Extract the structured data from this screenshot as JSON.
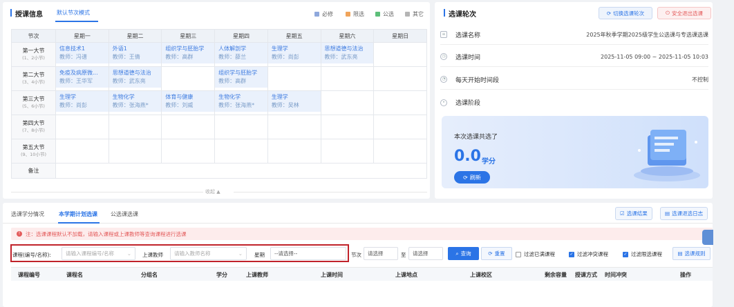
{
  "schedule": {
    "title": "授课信息",
    "mode_tab": "默认节次模式",
    "legend": [
      {
        "label": "必修",
        "color": "#8fa8dc"
      },
      {
        "label": "限选",
        "color": "#f0a45b"
      },
      {
        "label": "公选",
        "color": "#5dbf7a"
      },
      {
        "label": "其它",
        "color": "#b5b5b5"
      }
    ],
    "col_header": "节次",
    "days": [
      "星期一",
      "星期二",
      "星期三",
      "星期四",
      "星期五",
      "星期六",
      "星期日"
    ],
    "periods": [
      {
        "name": "第一大节",
        "sub": "(1、2小节)"
      },
      {
        "name": "第二大节",
        "sub": "(3、4小节)"
      },
      {
        "name": "第三大节",
        "sub": "(5、6小节)"
      },
      {
        "name": "第四大节",
        "sub": "(7、8小节)"
      },
      {
        "name": "第五大节",
        "sub": "(9、10小节)"
      },
      {
        "name": "备注",
        "sub": ""
      }
    ],
    "cells": {
      "r0c0": {
        "course": "信息技术1",
        "teacher": "教师：冯谱"
      },
      "r0c1": {
        "course": "外语1",
        "teacher": "教师：王倩"
      },
      "r0c2": {
        "course": "组织学与胚胎学",
        "teacher": "教师：高群"
      },
      "r0c3": {
        "course": "人体解剖学",
        "teacher": "教师：薛兰"
      },
      "r0c4": {
        "course": "生理学",
        "teacher": "教师：尚彭"
      },
      "r0c5": {
        "course": "思想道德与法治",
        "teacher": "教师：武东亮"
      },
      "r1c0": {
        "course": "免疫及病原微...",
        "teacher": "教师：王华军"
      },
      "r1c1": {
        "course": "思想道德与法治",
        "teacher": "教师：武东亮"
      },
      "r1c3": {
        "course": "组织学与胚胎学",
        "teacher": "教师：高群"
      },
      "r2c0": {
        "course": "生理学",
        "teacher": "教师：尚彭"
      },
      "r2c1": {
        "course": "生物化学",
        "teacher": "教师：张海燕*"
      },
      "r2c2": {
        "course": "体育与健康",
        "teacher": "教师：刘威"
      },
      "r2c3": {
        "course": "生物化学",
        "teacher": "教师：张海燕*"
      },
      "r2c4": {
        "course": "生理学",
        "teacher": "教师：吴林"
      }
    },
    "collapse": "收起"
  },
  "round": {
    "title": "选课轮次",
    "switch_btn": "切换选课轮次",
    "logout_btn": "安全退出选课",
    "rows": [
      {
        "label": "选课名称",
        "value": "2025年秋季学期2025级学生公选课与专选课选课"
      },
      {
        "label": "选课时间",
        "value": "2025-11-05 09:00 ~ 2025-11-05 10:03"
      },
      {
        "label": "每天开始时间段",
        "value": "不控制"
      },
      {
        "label": "选课阶段",
        "value": ""
      }
    ],
    "credits_label": "本次选课共选了",
    "credits_value": "0.0",
    "credits_unit": "学分",
    "refresh": "刷新"
  },
  "select": {
    "tabs": [
      "选课学分情况",
      "本学期计划选课",
      "公选课选课"
    ],
    "result_btn": "选课结果",
    "log_btn": "选课退选日志",
    "notice": "注：选课课程默认不加载，请输入课程或上课教师等查询课程进行选课",
    "filters": {
      "course_label": "课程(编号/名称):",
      "course_ph": "请输入课程编号/名称",
      "teacher_label": "上课教师",
      "teacher_ph": "请输入教师名称",
      "week_label": "星期",
      "week_value": "--请选择--",
      "period_label": "节次",
      "period_from": "请选择",
      "period_to_label": "至",
      "period_to": "请选择",
      "query": "查询",
      "reset": "重置",
      "cb_full": "过滤已满课程",
      "cb_conflict": "过滤冲突课程",
      "cb_limit": "过滤限选课程",
      "rules": "选课规则"
    },
    "columns": [
      "课程编号",
      "课程名",
      "分组名",
      "学分",
      "上课教师",
      "上课时间",
      "上课地点",
      "上课校区",
      "剩余容量",
      "授课方式",
      "时间冲突",
      "操作"
    ]
  }
}
